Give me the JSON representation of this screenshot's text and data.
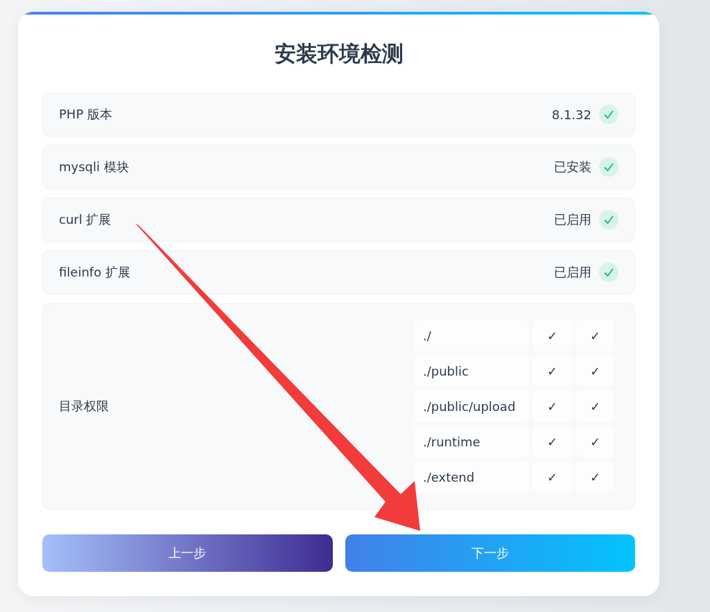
{
  "title": "安装环境检测",
  "checks": [
    {
      "label": "PHP 版本",
      "value": "8.1.32",
      "ok": true
    },
    {
      "label": "mysqli 模块",
      "value": "已安装",
      "ok": true
    },
    {
      "label": "curl 扩展",
      "value": "已启用",
      "ok": true
    },
    {
      "label": "fileinfo 扩展",
      "value": "已启用",
      "ok": true
    }
  ],
  "permissions": {
    "label": "目录权限",
    "rows": [
      {
        "path": "./",
        "read": "✓",
        "write": "✓"
      },
      {
        "path": "./public",
        "read": "✓",
        "write": "✓"
      },
      {
        "path": "./public/upload",
        "read": "✓",
        "write": "✓"
      },
      {
        "path": "./runtime",
        "read": "✓",
        "write": "✓"
      },
      {
        "path": "./extend",
        "read": "✓",
        "write": "✓"
      }
    ]
  },
  "buttons": [
    {
      "label": "上一步",
      "kind": "prev"
    },
    {
      "label": "下一步",
      "kind": "next"
    }
  ]
}
